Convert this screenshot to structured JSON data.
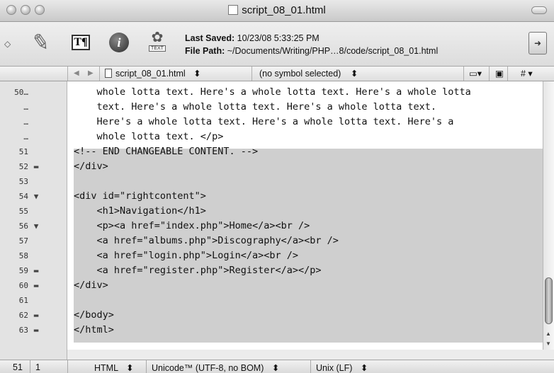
{
  "window": {
    "title": "script_08_01.html"
  },
  "toolbar": {
    "last_saved_label": "Last Saved:",
    "last_saved_value": "10/23/08 5:33:25 PM",
    "file_path_label": "File Path:",
    "file_path_value": "~/Documents/Writing/PHP…8/code/script_08_01.html",
    "text_tag": "TEXT",
    "tbox_glyph": "T¶",
    "info_glyph": "i"
  },
  "navbar": {
    "back": "◀",
    "forward": "▶",
    "filename": "script_08_01.html",
    "symbol": "(no symbol selected)",
    "updown": "⬍",
    "hash": "#"
  },
  "editor": {
    "lines": [
      {
        "num": "50…",
        "fold": "",
        "text": "    whole lotta text. Here's a whole lotta text. Here's a whole lotta"
      },
      {
        "num": "…",
        "fold": "",
        "text": "    text. Here's a whole lotta text. Here's a whole lotta text."
      },
      {
        "num": "…",
        "fold": "",
        "text": "    Here's a whole lotta text. Here's a whole lotta text. Here's a"
      },
      {
        "num": "…",
        "fold": "",
        "text": "    whole lotta text. </p>"
      },
      {
        "num": "51",
        "fold": "",
        "text": "<!-- END CHANGEABLE CONTENT. -->"
      },
      {
        "num": "52",
        "fold": "▬",
        "text": "</div>"
      },
      {
        "num": "53",
        "fold": "",
        "text": ""
      },
      {
        "num": "54",
        "fold": "▼",
        "text": "<div id=\"rightcontent\">"
      },
      {
        "num": "55",
        "fold": "",
        "text": "    <h1>Navigation</h1>"
      },
      {
        "num": "56",
        "fold": "▼",
        "text": "    <p><a href=\"index.php\">Home</a><br />"
      },
      {
        "num": "57",
        "fold": "",
        "text": "    <a href=\"albums.php\">Discography</a><br />"
      },
      {
        "num": "58",
        "fold": "",
        "text": "    <a href=\"login.php\">Login</a><br />"
      },
      {
        "num": "59",
        "fold": "▬",
        "text": "    <a href=\"register.php\">Register</a></p>"
      },
      {
        "num": "60",
        "fold": "▬",
        "text": "</div>"
      },
      {
        "num": "61",
        "fold": "",
        "text": ""
      },
      {
        "num": "62",
        "fold": "▬",
        "text": "</body>"
      },
      {
        "num": "63",
        "fold": "▬",
        "text": "</html>"
      }
    ]
  },
  "statusbar": {
    "line": "51",
    "col": "1",
    "language": "HTML",
    "encoding": "Unicode™ (UTF-8, no BOM)",
    "line_endings": "Unix (LF)",
    "updown": "⬍"
  }
}
